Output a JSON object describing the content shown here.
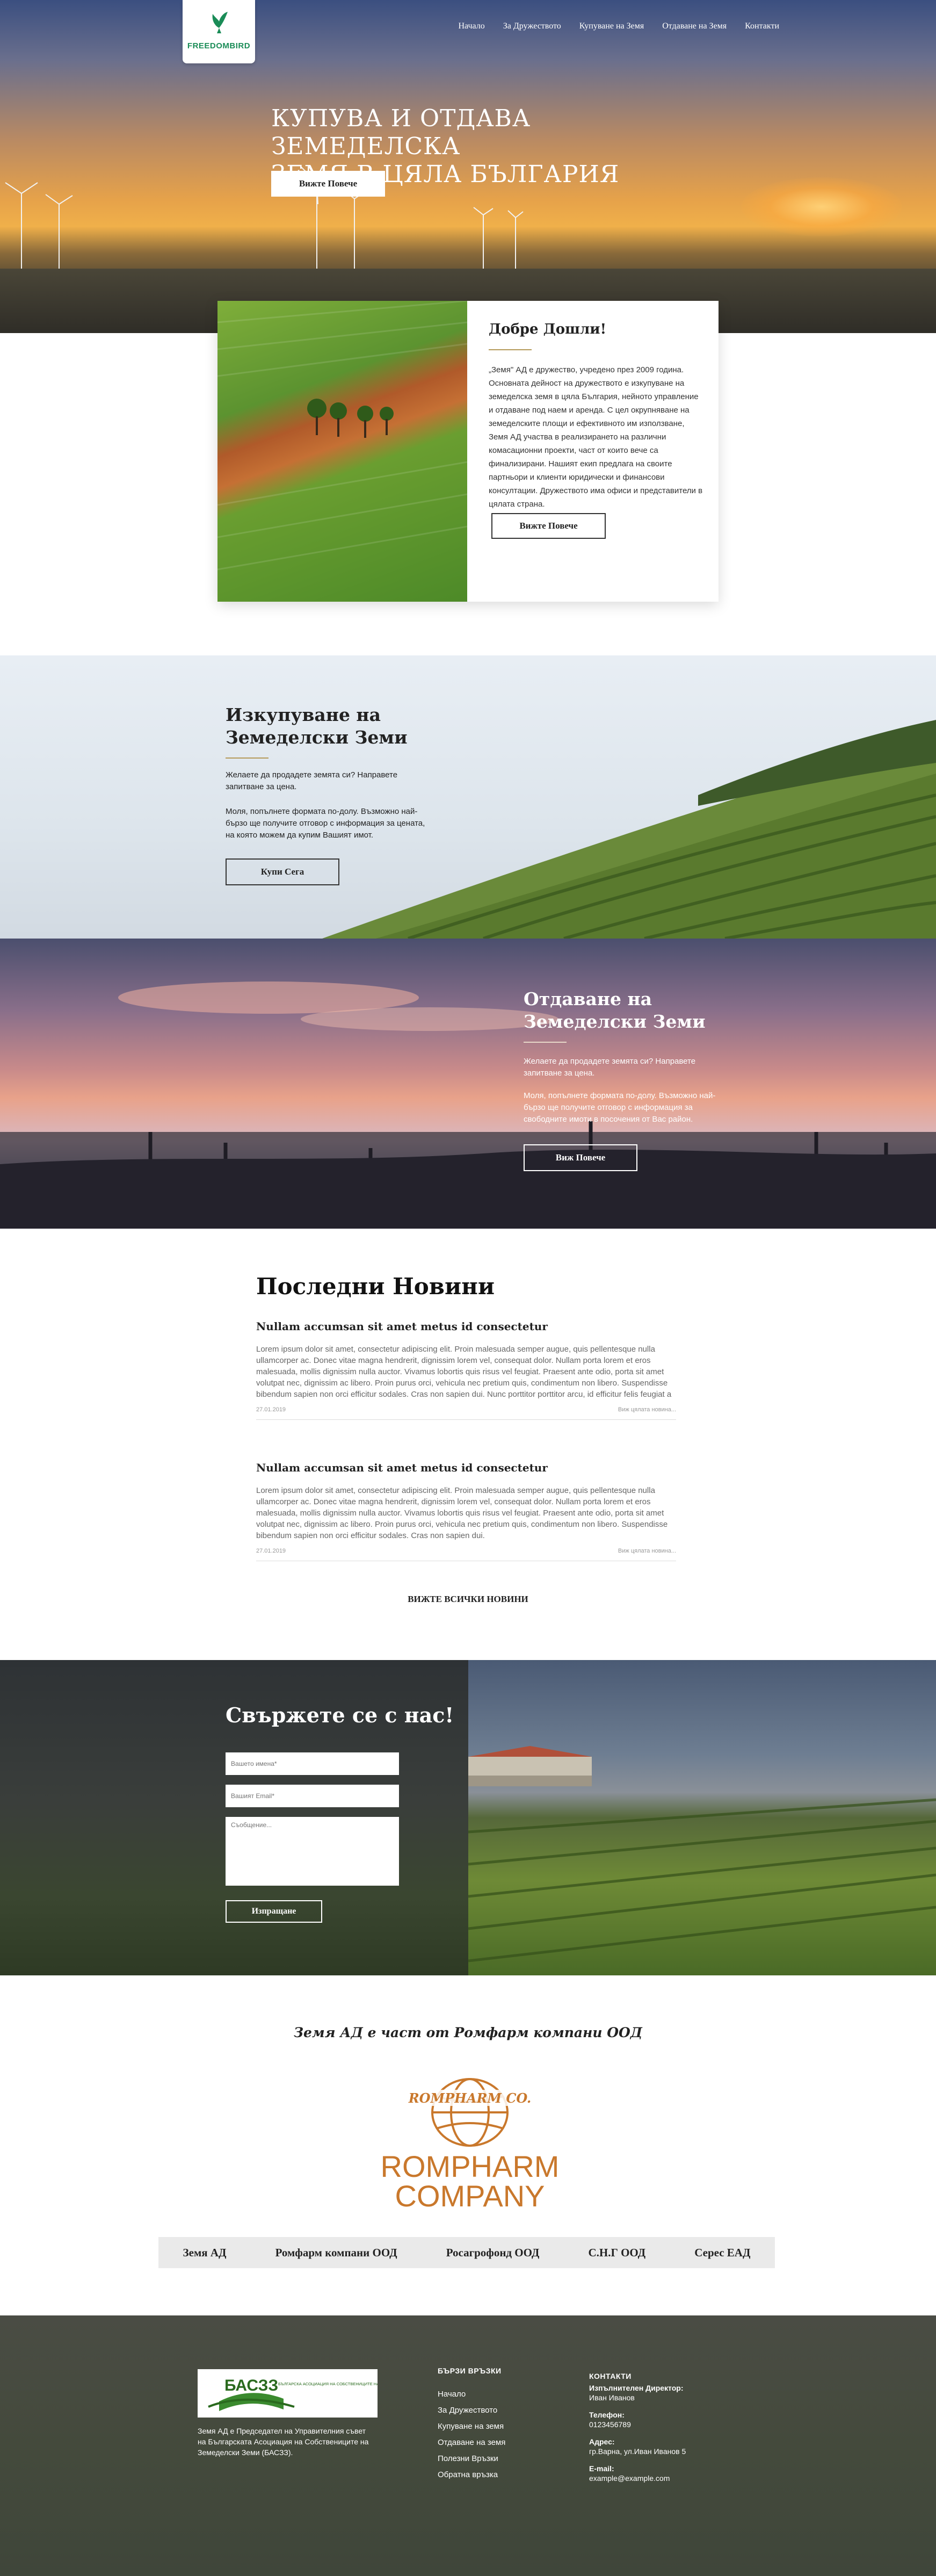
{
  "brand": {
    "logo_text": "FREEDOMBIRD"
  },
  "nav": [
    {
      "label": "Начало"
    },
    {
      "label": "За Дружеството"
    },
    {
      "label": "Купуване на Земя"
    },
    {
      "label": "Отдаване на Земя"
    },
    {
      "label": "Контакти"
    }
  ],
  "hero": {
    "title_line1": "КУПУВА И ОТДАВА ЗЕМЕДЕЛСКА",
    "title_line2": "ЗЕМЯ В ЦЯЛА БЪЛГАРИЯ",
    "button": "Вижте Повече"
  },
  "welcome": {
    "title": "Добре Дошли!",
    "text": "„Земя\" АД е дружество, учредено през 2009 година. Основната дейност на дружеството е изкупуване на земеделска земя в цяла България, нейното управление и отдаване под наем и аренда. С цел окрупняване на земеделските площи и ефективното им използване, Земя АД участва в реализирането на различни комасационни проекти, част от които вече са финализирани. Нашият екип предлага на своите партньори и клиенти юридически и финансови консултации. Дружеството има офиси и представители в цялата страна.",
    "button": "Вижте Повече"
  },
  "buy": {
    "title_line1": "Изкупуване на",
    "title_line2": "Земеделски Земи",
    "p1": "Желаете да продадете земята си? Направете запитване за цена.",
    "p2": "Моля, попълнете формата по-долу. Възможно най-бързо ще получите отговор с информация за цената, на която можем да купим Вашият имот.",
    "button": "Купи Сега"
  },
  "sell": {
    "title_line1": "Отдаване на",
    "title_line2": "Земеделски Земи",
    "p1": "Желаете да продадете земята си? Направете запитване за цена.",
    "p2": "Моля, попълнете формата по-долу. Възможно най-бързо ще получите отговор с информация за свободните имоти в посочения от Вас район.",
    "button": "Виж Повече"
  },
  "news": {
    "title": "Последни Новини",
    "items": [
      {
        "title": "Nullam accumsan sit amet metus id consectetur",
        "text": "Lorem ipsum dolor sit amet, consectetur adipiscing elit. Proin malesuada semper augue, quis pellentesque nulla ullamcorper ac. Donec vitae magna hendrerit, dignissim lorem vel, consequat dolor. Nullam porta lorem et eros malesuada, mollis dignissim nulla auctor. Vivamus lobortis quis risus vel feugiat. Praesent ante odio, porta sit amet volutpat nec, dignissim ac libero. Proin purus orci, vehicula nec pretium quis, condimentum non libero. Suspendisse bibendum sapien non orci efficitur sodales. Cras non sapien dui. Nunc porttitor porttitor arcu, id efficitur felis feugiat a",
        "date": "27.01.2019",
        "more": "Виж цялата новина..."
      },
      {
        "title": "Nullam accumsan sit amet metus id consectetur",
        "text": "Lorem ipsum dolor sit amet, consectetur adipiscing elit. Proin malesuada semper augue, quis pellentesque nulla ullamcorper ac. Donec vitae magna hendrerit, dignissim lorem vel, consequat dolor. Nullam porta lorem et eros malesuada, mollis dignissim nulla auctor. Vivamus lobortis quis risus vel feugiat. Praesent ante odio, porta sit amet volutpat nec, dignissim ac libero. Proin purus orci, vehicula nec pretium quis, condimentum non libero. Suspendisse bibendum sapien non orci efficitur sodales. Cras non sapien dui.",
        "date": "27.01.2019",
        "more": "Виж цялата новина..."
      }
    ],
    "all_link": "ВИЖТЕ ВСИЧКИ НОВИНИ"
  },
  "contact": {
    "title": "Свържете се с нас!",
    "name_placeholder": "Вашето имена*",
    "email_placeholder": "Вашият Email*",
    "message_placeholder": "Съобщение...",
    "button": "Изпращане"
  },
  "partner": {
    "title": "Земя АД е част от Ромфарм компани ООД",
    "logo_top": "ROMPHARM CO.",
    "logo_line1": "ROMPHARM",
    "logo_line2": "COMPANY",
    "bar": [
      "Земя АД",
      "Ромфарм компани ООД",
      "Росагрофонд ООД",
      "С.Н.Г ООД",
      "Серес ЕАД"
    ]
  },
  "footer": {
    "bacz_abbr": "БАСЗЗ",
    "bacz_name": "БЪЛГАРСКА АСОЦИАЦИЯ НА СОБСТВЕНИЦИТЕ НА ЗЕМЕДЕЛСКИ ЗЕМИ",
    "about": "Земя АД е Председател на Управителния съвет на Българската Асоциация на Собствениците на Земеделски Земи (БАСЗЗ).",
    "quick_title": "БЪРЗИ ВРЪЗКИ",
    "quick_links": [
      "Начало",
      "За Дружеството",
      "Купуване на земя",
      "Отдаване на земя",
      "Полезни Връзки",
      "Обратна връзка"
    ],
    "contacts_title": "КОНТАКТИ",
    "director_label": "Изпълнителен Директор:",
    "director_value": "Иван Иванов",
    "phone_label": "Телефон:",
    "phone_value": "0123456789",
    "address_label": "Адрес:",
    "address_value": "гр.Варна, ул.Иван Иванов 5",
    "email_label": "E-mail:",
    "email_value": "example@example.com"
  },
  "colors": {
    "accent_gold": "#b59a5a",
    "brand_green": "#1a8c57",
    "rompharm_orange": "#c9782c"
  }
}
